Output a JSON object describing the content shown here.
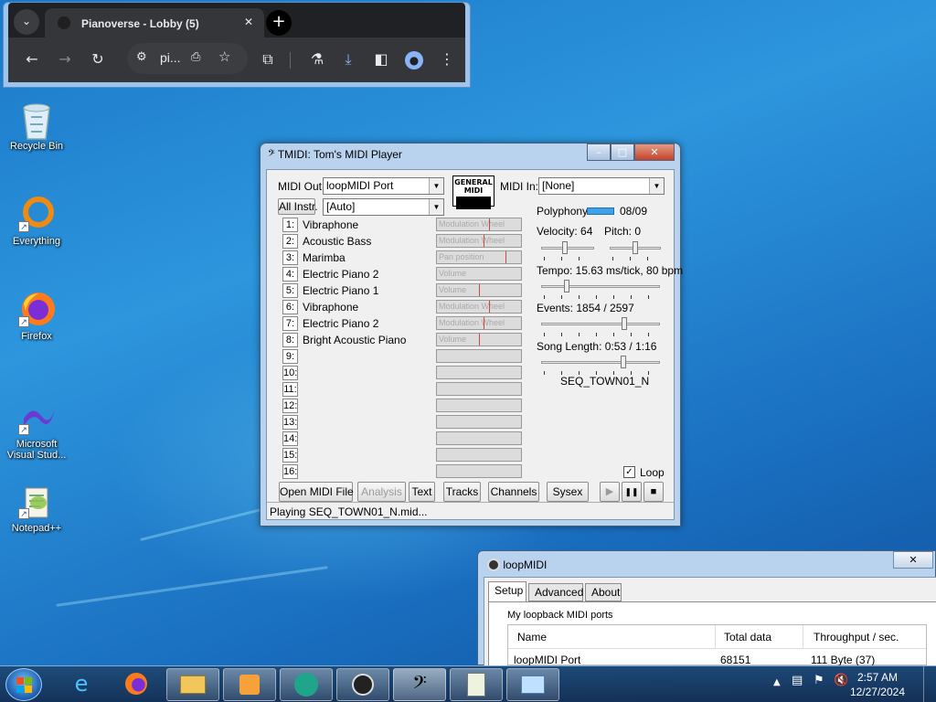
{
  "desktop_icons": [
    {
      "label": "Recycle Bin",
      "icon": "recycle-bin-icon"
    },
    {
      "label": "Everything",
      "icon": "everything-icon"
    },
    {
      "label": "Firefox",
      "icon": "firefox-icon"
    },
    {
      "label": "Microsoft Visual Stud...",
      "icon": "visual-studio-icon"
    },
    {
      "label": "Notepad++",
      "icon": "notepad-plus-plus-icon"
    }
  ],
  "chrome": {
    "tab_title": "Pianoverse - Lobby (5)",
    "omnibox_text": "pi...",
    "caption": {
      "min": "—",
      "max": "□",
      "close": "✕"
    }
  },
  "tmidi": {
    "title": "TMIDI: Tom's MIDI Player",
    "midi_out_label": "MIDI Out:",
    "midi_out_value": "loopMIDI Port",
    "all_instr_label": "All Instr.",
    "instr_value": "[Auto]",
    "gm_logo": "GENERAL MIDI",
    "midi_in_label": "MIDI In:",
    "midi_in_value": "[None]",
    "channels": [
      {
        "num": "1:",
        "name": "Vibraphone",
        "ctrl": "Modulation Wheel",
        "level": 0.62
      },
      {
        "num": "2:",
        "name": "Acoustic Bass",
        "ctrl": "Modulation Wheel",
        "level": 0.55
      },
      {
        "num": "3:",
        "name": "Marimba",
        "ctrl": "Pan position",
        "level": 0.82
      },
      {
        "num": "4:",
        "name": "Electric Piano 2",
        "ctrl": "Volume",
        "level": 0
      },
      {
        "num": "5:",
        "name": "Electric Piano 1",
        "ctrl": "Volume",
        "level": 0.5
      },
      {
        "num": "6:",
        "name": "Vibraphone",
        "ctrl": "Modulation Wheel",
        "level": 0.62
      },
      {
        "num": "7:",
        "name": "Electric Piano 2",
        "ctrl": "Modulation Wheel",
        "level": 0.55
      },
      {
        "num": "8:",
        "name": "Bright Acoustic Piano",
        "ctrl": "Volume",
        "level": 0.5
      },
      {
        "num": "9:",
        "name": "",
        "ctrl": "",
        "level": 0
      },
      {
        "num": "10:",
        "name": "",
        "ctrl": "",
        "level": 0
      },
      {
        "num": "11:",
        "name": "",
        "ctrl": "",
        "level": 0
      },
      {
        "num": "12:",
        "name": "",
        "ctrl": "",
        "level": 0
      },
      {
        "num": "13:",
        "name": "",
        "ctrl": "",
        "level": 0
      },
      {
        "num": "14:",
        "name": "",
        "ctrl": "",
        "level": 0
      },
      {
        "num": "15:",
        "name": "",
        "ctrl": "",
        "level": 0
      },
      {
        "num": "16:",
        "name": "",
        "ctrl": "",
        "level": 0
      }
    ],
    "polyphony_label": "Polyphony:",
    "polyphony_value": "08/09",
    "velocity_label": "Velocity: 64",
    "velocity_level": 0.45,
    "pitch_label": "Pitch: 0",
    "pitch_level": 0.5,
    "tempo_label": "Tempo: 15.63 ms/tick, 80 bpm",
    "tempo_level": 0.2,
    "events_label": "Events: 1854 / 2597",
    "events_level": 0.71,
    "song_length_label": "Song Length: 0:53 / 1:16",
    "song_level": 0.7,
    "file_name": "SEQ_TOWN01_N",
    "loop_label": "Loop",
    "loop_checked": true,
    "buttons": {
      "open": "Open MIDI File",
      "analysis": "Analysis",
      "text": "Text",
      "tracks": "Tracks",
      "channels": "Channels",
      "sysex": "Sysex"
    },
    "transport": {
      "play": "▶",
      "pause": "❚❚",
      "stop": "■"
    },
    "status": "Playing SEQ_TOWN01_N.mid..."
  },
  "loopmidi": {
    "title": "loopMIDI",
    "tabs": [
      "Setup",
      "Advanced",
      "About"
    ],
    "group_label": "My loopback MIDI ports",
    "columns": [
      "Name",
      "Total data",
      "Throughput / sec."
    ],
    "rows": [
      {
        "name": "loopMIDI Port",
        "total": "68151",
        "throughput": "111 Byte (37)"
      }
    ]
  },
  "taskbar": {
    "time": "2:57 AM",
    "date": "12/27/2024"
  }
}
